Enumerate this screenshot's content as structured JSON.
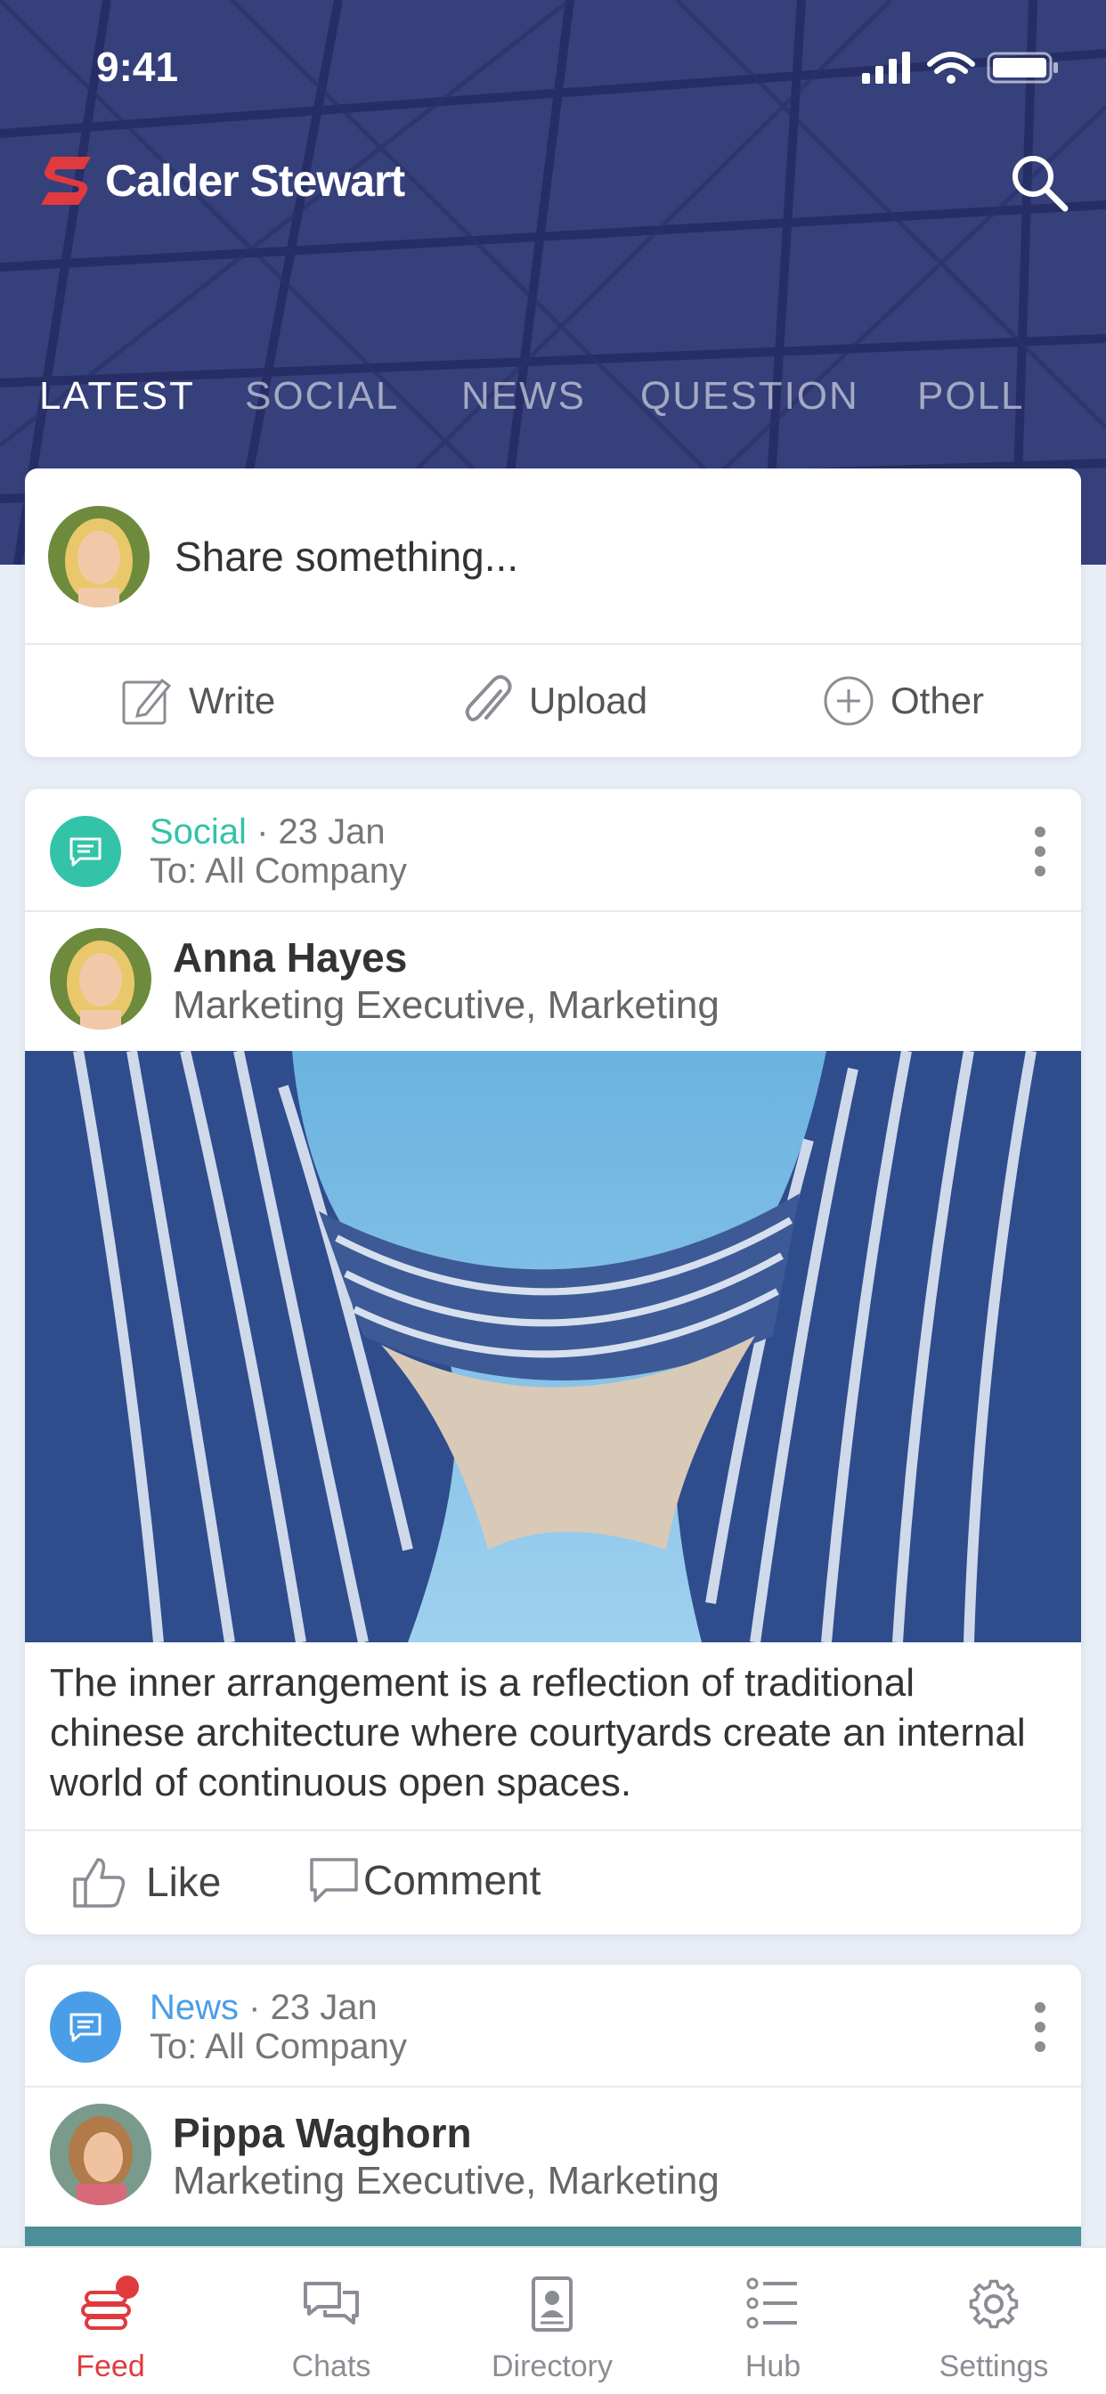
{
  "status_bar": {
    "time": "9:41"
  },
  "header": {
    "brand": "Calder Stewart",
    "tabs": [
      {
        "label": "LATEST",
        "active": true
      },
      {
        "label": "SOCIAL",
        "active": false
      },
      {
        "label": "NEWS",
        "active": false
      },
      {
        "label": "QUESTION",
        "active": false
      },
      {
        "label": "POLL",
        "active": false
      }
    ]
  },
  "composer": {
    "placeholder": "Share something...",
    "actions": [
      {
        "label": "Write",
        "icon": "pencil-square-icon"
      },
      {
        "label": "Upload",
        "icon": "paperclip-icon"
      },
      {
        "label": "Other",
        "icon": "plus-circle-icon"
      }
    ]
  },
  "posts": [
    {
      "category": "Social",
      "category_color": "#33c3a9",
      "date": "· 23 Jan",
      "audience": "To: All Company",
      "author": "Anna Hayes",
      "role": "Marketing Executive, Marketing",
      "text": "The inner arrangement is a reflection of traditional chinese architecture where courtyards create an internal world of continuous open spaces.",
      "like_label": "Like",
      "comment_label": "Comment"
    },
    {
      "category": "News",
      "category_color": "#4a9ee8",
      "date": "· 23 Jan",
      "audience": "To: All Company",
      "author": "Pippa Waghorn",
      "role": "Marketing Executive, Marketing"
    }
  ],
  "bottom_nav": [
    {
      "label": "Feed",
      "active": true,
      "has_badge": true
    },
    {
      "label": "Chats",
      "active": false
    },
    {
      "label": "Directory",
      "active": false
    },
    {
      "label": "Hub",
      "active": false
    },
    {
      "label": "Settings",
      "active": false
    }
  ],
  "colors": {
    "header_bg": "#36407a",
    "brand_red": "#e03a3e",
    "page_bg": "#e9eef6"
  }
}
